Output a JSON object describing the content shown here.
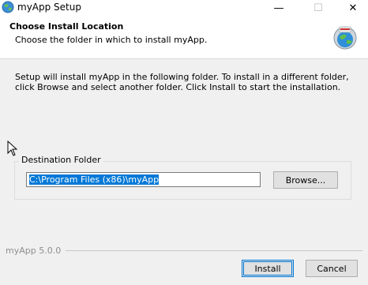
{
  "window": {
    "title": "myApp Setup",
    "minimize_glyph": "—",
    "maximize_glyph": "☐",
    "close_glyph": "✕"
  },
  "header": {
    "title": "Choose Install Location",
    "subtitle": "Choose the folder in which to install myApp."
  },
  "body": {
    "intro_text": "Setup will install myApp in the following folder. To install in a different folder, click Browse and select another folder. Click Install to start the installation."
  },
  "destination": {
    "group_label": "Destination Folder",
    "path": "C:\\Program Files (x86)\\myApp",
    "browse_label": "Browse..."
  },
  "footer": {
    "brand": "myApp 5.0.0",
    "install_label": "Install",
    "cancel_label": "Cancel"
  },
  "colors": {
    "accent": "#0078d7",
    "window_bg": "#f0f0f0"
  },
  "icons": {
    "app": "installer-globe-icon",
    "header": "installer-globe-icon"
  }
}
